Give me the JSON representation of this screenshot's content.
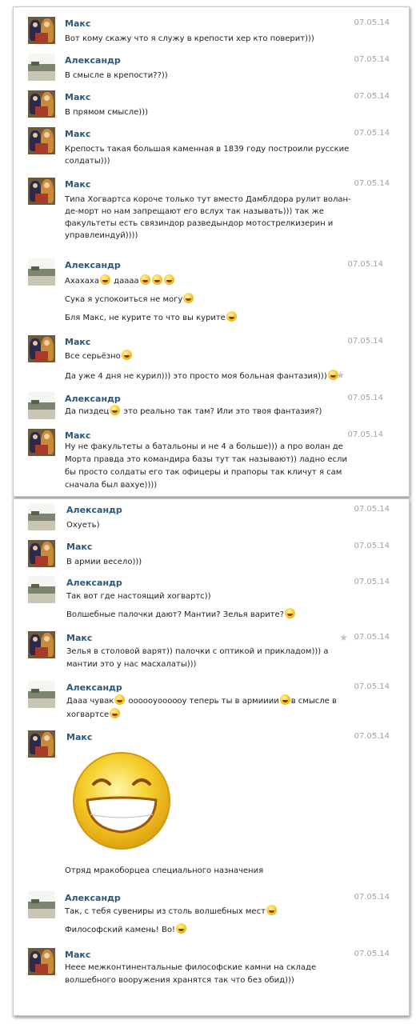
{
  "messages": [
    {
      "author": "Макс",
      "date": "07.05.14",
      "lines": [
        "Вот кому скажу что я служу в крепости хер кто поверит)))"
      ]
    },
    {
      "author": "Александр",
      "date": "07.05.14",
      "lines": [
        "В смысле в крепости??))"
      ]
    },
    {
      "author": "Макс",
      "date": "07.05.14",
      "lines": [
        "В прямом смысле)))"
      ]
    },
    {
      "author": "Макс",
      "date": "07.05.14",
      "lines": [
        "Крепость такая большая каменная в 1839 году построили русские",
        "солдаты)))"
      ]
    },
    {
      "author": "Макс",
      "date": "07.05.14",
      "lines": [
        "Типа Хогвартса короче только тут вместо Дамблдора рулит волан-",
        "де-морт но нам запрещают его вслух так называть))) так же",
        "факультеты есть связиндор разведындор мотострелкизерин и",
        "управлеиндуй))))"
      ]
    },
    {
      "author": "Александр",
      "date": "07.05.14",
      "lines": [
        "Ахахаха",
        "дaааа",
        "Сука я успокоиться не могу",
        "Бля Макс, не курите то что вы курите"
      ]
    },
    {
      "author": "Макс",
      "date": "07.05.14",
      "lines": [
        "Все серьёзно",
        "Да уже 4 дня не курил))) это просто моя больная фантазия)))"
      ]
    },
    {
      "author": "Александр",
      "date": "07.05.14",
      "lines": [
        "Да пиздец",
        "это реально так там? Или это твоя фантазия?)"
      ]
    },
    {
      "author": "Макс",
      "date": "07.05.14",
      "lines": [
        "Ну не факультеты а батальоны и не 4 а больше))) а про волан де",
        "Морта правда это командира базы тут так называют)) ладно если",
        "бы просто солдаты его так офицеры и прапоры так кличут я сам",
        "сначала был вахуе))))"
      ]
    },
    {
      "author": "Александр",
      "date": "07.05.14",
      "lines": [
        "Охуеть)"
      ]
    },
    {
      "author": "Макс",
      "date": "07.05.14",
      "lines": [
        "В армии весело)))"
      ]
    },
    {
      "author": "Александр",
      "date": "07.05.14",
      "lines": [
        "Так вот где настоящий хогвартс))",
        "Волшебные палочки дают? Мантии? Зелья варите?"
      ]
    },
    {
      "author": "Макс",
      "date": "07.05.14",
      "lines": [
        "Зелья в столовой варят)) палочки с оптикой и прикладом))) а",
        "мантии это у нас масхалаты)))"
      ]
    },
    {
      "author": "Александр",
      "date": "07.05.14",
      "lines": [
        "Дааа чувак",
        "ooooоуoooooу теперь ты в армииии",
        "в смысле в",
        "хогвартсе"
      ]
    },
    {
      "author": "Макс",
      "date": "07.05.14",
      "lines": [
        "Отряд мракоборцеа специального назначения"
      ]
    },
    {
      "author": "Александр",
      "date": "07.05.14",
      "lines": [
        "Так, с тебя сувениры из столь волшебных мест",
        "Философский камень! Во!"
      ]
    },
    {
      "author": "Макс",
      "date": "07.05.14",
      "lines": [
        "Неее межконтинентальные философские камни на складе",
        "волшебного вооружения хранятся так что без обид)))"
      ]
    }
  ],
  "icons": {
    "emoji": "smile-icon",
    "favorite": "star-icon",
    "sticker": "big-smile-sticker"
  },
  "colors": {
    "author": "#2b587a",
    "date": "#9aa5b0",
    "text": "#1d1d1d"
  }
}
